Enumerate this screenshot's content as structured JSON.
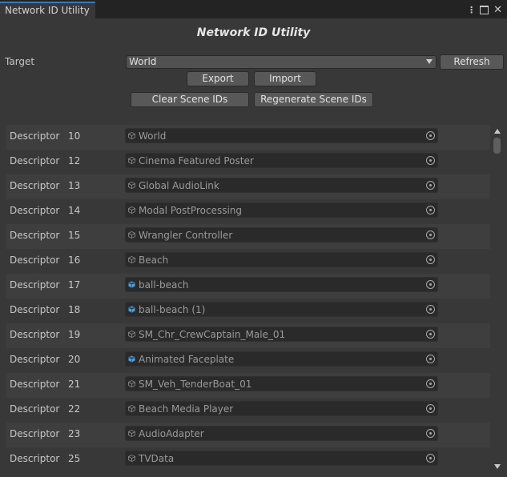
{
  "window": {
    "tab_title": "Network ID Utility",
    "title": "Network ID Utility",
    "menu_icon": "kebab-menu-icon",
    "maximize_icon": "maximize-icon",
    "close_icon": "close-icon"
  },
  "target": {
    "label": "Target",
    "selected": "World",
    "refresh_label": "Refresh"
  },
  "actions": {
    "export_label": "Export",
    "import_label": "Import",
    "clear_label": "Clear Scene IDs",
    "regenerate_label": "Regenerate Scene IDs"
  },
  "rows": [
    {
      "label": "Descriptor",
      "id": "10",
      "object": "World",
      "icon": "gameobject-icon"
    },
    {
      "label": "Descriptor",
      "id": "12",
      "object": "Cinema Featured Poster",
      "icon": "gameobject-icon"
    },
    {
      "label": "Descriptor",
      "id": "13",
      "object": "Global AudioLink",
      "icon": "gameobject-icon"
    },
    {
      "label": "Descriptor",
      "id": "14",
      "object": "Modal PostProcessing",
      "icon": "gameobject-icon"
    },
    {
      "label": "Descriptor",
      "id": "15",
      "object": "Wrangler Controller",
      "icon": "gameobject-icon"
    },
    {
      "label": "Descriptor",
      "id": "16",
      "object": "Beach",
      "icon": "gameobject-icon"
    },
    {
      "label": "Descriptor",
      "id": "17",
      "object": "ball-beach",
      "icon": "prefab-icon"
    },
    {
      "label": "Descriptor",
      "id": "18",
      "object": "ball-beach (1)",
      "icon": "prefab-icon"
    },
    {
      "label": "Descriptor",
      "id": "19",
      "object": "SM_Chr_CrewCaptain_Male_01",
      "icon": "gameobject-icon"
    },
    {
      "label": "Descriptor",
      "id": "20",
      "object": "Animated Faceplate",
      "icon": "prefab-icon"
    },
    {
      "label": "Descriptor",
      "id": "21",
      "object": "SM_Veh_TenderBoat_01",
      "icon": "gameobject-icon"
    },
    {
      "label": "Descriptor",
      "id": "22",
      "object": "Beach Media Player",
      "icon": "gameobject-icon"
    },
    {
      "label": "Descriptor",
      "id": "23",
      "object": "AudioAdapter",
      "icon": "gameobject-icon"
    },
    {
      "label": "Descriptor",
      "id": "25",
      "object": "TVData",
      "icon": "gameobject-icon"
    }
  ],
  "colors": {
    "accent": "#3a79bb",
    "prefab_icon": "#5ba0d6",
    "gameobject_icon": "#8a8a8a"
  }
}
